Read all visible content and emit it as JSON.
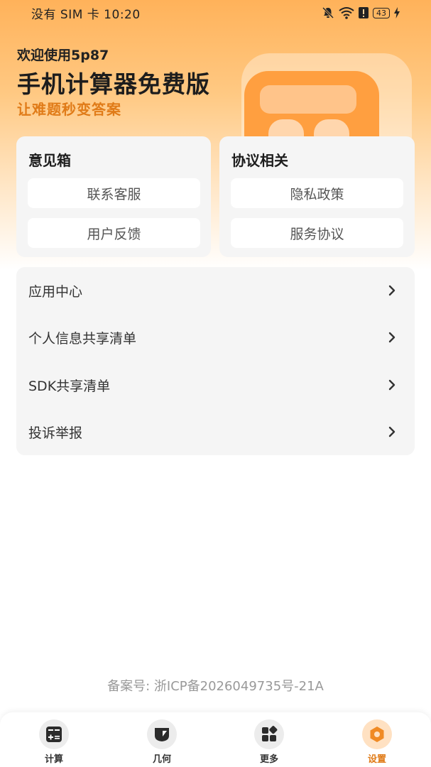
{
  "status_bar": {
    "carrier_time": "没有 SIM 卡 10:20",
    "battery": "43",
    "icons": [
      "mute-bell-icon",
      "wifi-icon",
      "alert-icon",
      "battery-icon",
      "charging-icon"
    ]
  },
  "hero": {
    "welcome": "欢迎使用5p87",
    "title": "手机计算器免费版",
    "slogan": "让难题秒变答案"
  },
  "feedback_card": {
    "title": "意见箱",
    "buttons": [
      "联系客服",
      "用户反馈"
    ]
  },
  "agreement_card": {
    "title": "协议相关",
    "buttons": [
      "隐私政策",
      "服务协议"
    ]
  },
  "menu": {
    "items": [
      "应用中心",
      "个人信息共享清单",
      "SDK共享清单",
      "投诉举报"
    ]
  },
  "footer": {
    "icp": "备案号: 浙ICP备2026049735号-21A"
  },
  "tabs": [
    {
      "label": "计算",
      "icon": "calculator-icon",
      "active": false
    },
    {
      "label": "几何",
      "icon": "geometry-icon",
      "active": false
    },
    {
      "label": "更多",
      "icon": "grid-icon",
      "active": false
    },
    {
      "label": "设置",
      "icon": "settings-icon",
      "active": true
    }
  ],
  "colors": {
    "accent": "#e07b18",
    "hero_top": "#ffb25a",
    "card_bg": "#f5f5f5"
  }
}
